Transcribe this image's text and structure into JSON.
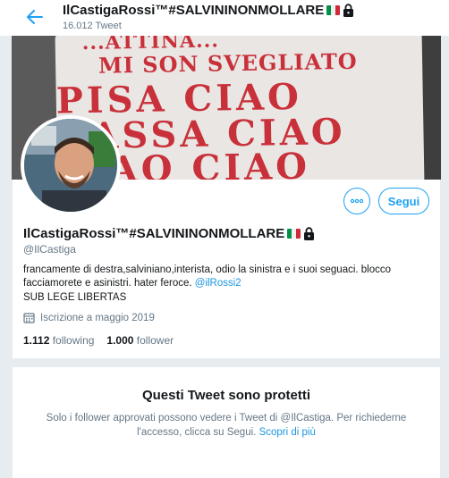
{
  "header": {
    "name": "IlCastigaRossi™#SALVININONMOLLARE",
    "tweet_count": "16.012 Tweet"
  },
  "banner": {
    "lines": [
      "...ATTINA...",
      "MI SON SVEGLIATO",
      "PISA CIAO",
      "BASSA CIAO",
      "CIAO CIAO"
    ]
  },
  "actions": {
    "follow_label": "Segui",
    "more_icon": "more-icon"
  },
  "profile": {
    "name": "IlCastigaRossi™#SALVININONMOLLARE",
    "handle": "@IlCastiga",
    "bio": "francamente di destra,salviniano,interista, odio la sinistra e i suoi seguaci. blocco facciamorete e asinistri. hater feroce.",
    "bio_link": "@ilRossi2",
    "motto": "SUB LEGE LIBERTAS",
    "joined": "Iscrizione a maggio 2019",
    "following_count": "1.112",
    "following_label": "following",
    "follower_count": "1.000",
    "follower_label": "follower"
  },
  "protected": {
    "title": "Questi Tweet sono protetti",
    "text": "Solo i follower approvati possono vedere i Tweet di @IlCastiga. Per richiederne l'accesso, clicca su Segui.",
    "link": "Scopri di più"
  },
  "colors": {
    "accent": "#1da1f2",
    "link": "#1b95e0",
    "muted": "#657786",
    "text": "#14171a",
    "banner_text": "#c9313a"
  }
}
